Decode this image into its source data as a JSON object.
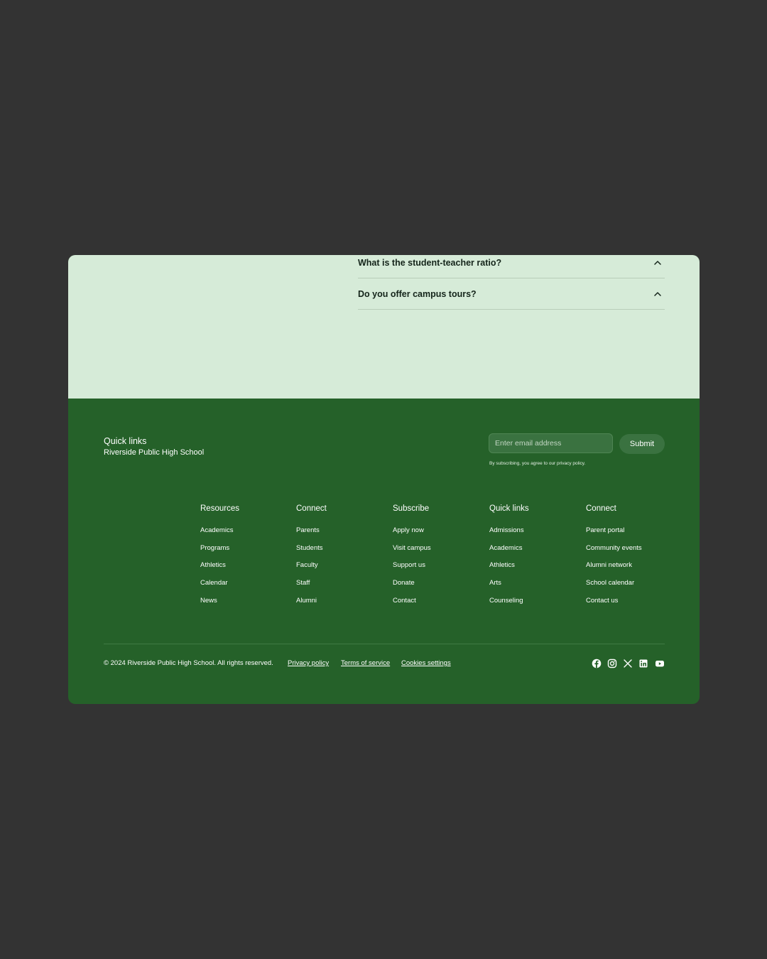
{
  "faq": {
    "items": [
      {
        "question": "What is the student-teacher ratio?"
      },
      {
        "question": "Do you offer campus tours?"
      }
    ]
  },
  "footer": {
    "title": "Quick links",
    "school_name": "Riverside Public High School",
    "newsletter": {
      "placeholder": "Enter email address",
      "submit_label": "Submit",
      "consent": "By subscribing, you agree to our privacy policy."
    },
    "columns": [
      {
        "title": "Resources",
        "links": [
          "Academics",
          "Programs",
          "Athletics",
          "Calendar",
          "News"
        ]
      },
      {
        "title": "Connect",
        "links": [
          "Parents",
          "Students",
          "Faculty",
          "Staff",
          "Alumni"
        ]
      },
      {
        "title": "Subscribe",
        "links": [
          "Apply now",
          "Visit campus",
          "Support us",
          "Donate",
          "Contact"
        ]
      },
      {
        "title": "Quick links",
        "links": [
          "Admissions",
          "Academics",
          "Athletics",
          "Arts",
          "Counseling"
        ]
      },
      {
        "title": "Connect",
        "links": [
          "Parent portal",
          "Community events",
          "Alumni network",
          "School calendar",
          "Contact us"
        ]
      }
    ],
    "copyright": "© 2024 Riverside Public High School. All rights reserved.",
    "legal_links": [
      "Privacy policy",
      "Terms of service",
      "Cookies settings"
    ],
    "social_icons": [
      "facebook-icon",
      "instagram-icon",
      "x-icon",
      "linkedin-icon",
      "youtube-icon"
    ]
  },
  "colors": {
    "page_background": "#333333",
    "faq_background": "#d6ebd8",
    "footer_background": "#256129",
    "input_background": "#3a7240"
  }
}
